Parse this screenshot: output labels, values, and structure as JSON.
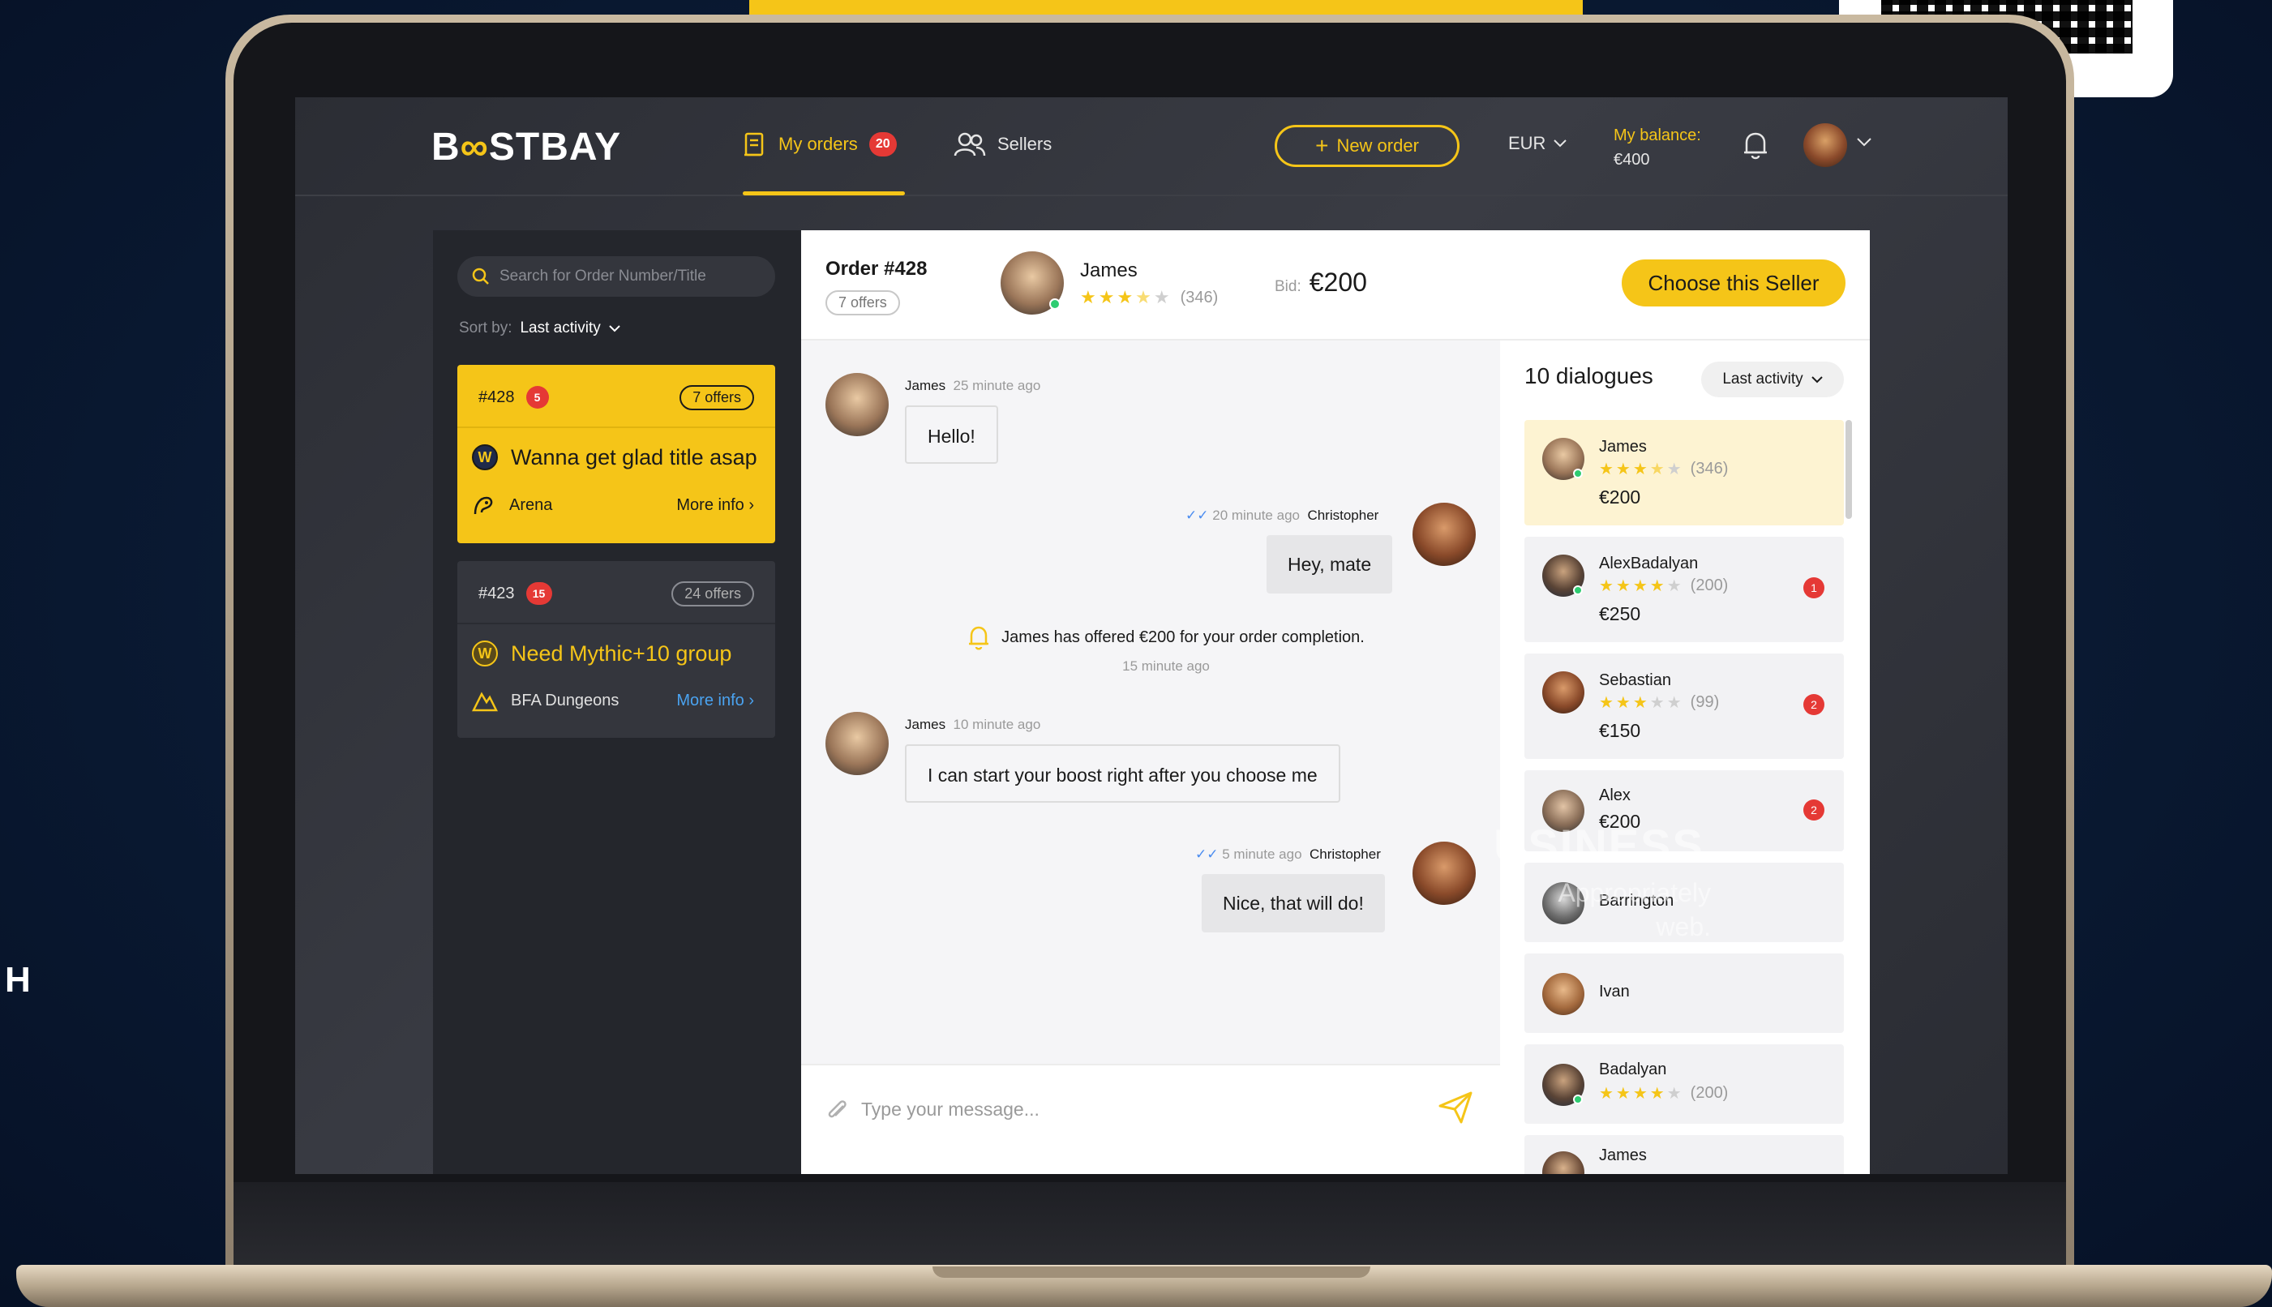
{
  "brand": {
    "logo_prefix": "B",
    "logo_infinity": "∞",
    "logo_suffix": "STBAY",
    "accent_color": "#f5c518",
    "badge_color": "#e53935"
  },
  "header": {
    "nav": [
      {
        "label": "My orders",
        "badge": "20",
        "icon": "orders-icon",
        "active": true
      },
      {
        "label": "Sellers",
        "icon": "users-icon",
        "active": false
      }
    ],
    "new_order_label": "New order",
    "currency": "EUR",
    "balance_label": "My balance:",
    "balance_value": "€400"
  },
  "orders_panel": {
    "search_placeholder": "Search for Order Number/Title",
    "sort_label": "Sort by:",
    "sort_value": "Last activity",
    "orders": [
      {
        "number": "#428",
        "badge": "5",
        "offers": "7 offers",
        "title": "Wanna get glad title asap",
        "category": "Arena",
        "more": "More info",
        "active": true
      },
      {
        "number": "#423",
        "badge": "15",
        "offers": "24 offers",
        "title": "Need Mythic+10 group",
        "category": "BFA Dungeons",
        "more": "More info",
        "active": false
      }
    ]
  },
  "chat": {
    "order_title": "Order #428",
    "offers": "7 offers",
    "seller_name": "James",
    "seller_rating": 3.5,
    "seller_reviews": "(346)",
    "bid_label": "Bid:",
    "bid_value": "€200",
    "choose_label": "Choose this Seller",
    "messages": [
      {
        "author": "James",
        "time": "25 minute ago",
        "text": "Hello!",
        "dir": "in"
      },
      {
        "author": "Christopher",
        "time": "20 minute ago",
        "text": "Hey, mate",
        "dir": "out"
      },
      {
        "author": "James",
        "time": "10 minute ago",
        "text": "I can start your boost right after you choose me",
        "dir": "in"
      },
      {
        "author": "Christopher",
        "time": "5 minute ago",
        "text": "Nice, that will do!",
        "dir": "out"
      }
    ],
    "system": {
      "text": "James has offered €200 for your order completion.",
      "time": "15 minute ago"
    },
    "compose_placeholder": "Type your message..."
  },
  "dialogues": {
    "title": "10 dialogues",
    "sort_value": "Last activity",
    "items": [
      {
        "name": "James",
        "rating": 3.5,
        "reviews": "(346)",
        "price": "€200",
        "unread": "",
        "online": true
      },
      {
        "name": "AlexBadalyan",
        "rating": 4,
        "reviews": "(200)",
        "price": "€250",
        "unread": "1",
        "online": true
      },
      {
        "name": "Sebastian",
        "rating": 3,
        "reviews": "(99)",
        "price": "€150",
        "unread": "2",
        "online": false
      },
      {
        "name": "Alex",
        "price": "€200",
        "unread": "2",
        "online": false
      },
      {
        "name": "Barrington",
        "online": false
      },
      {
        "name": "Ivan",
        "online": false
      },
      {
        "name": "Badalyan",
        "rating": 4,
        "reviews": "(200)",
        "online": true
      },
      {
        "name": "James",
        "online": false
      }
    ]
  },
  "overlay": {
    "watermark": "USINESS",
    "watermark_sub1": "Appropriately",
    "watermark_sub2": "web.",
    "side_letter": "H"
  }
}
